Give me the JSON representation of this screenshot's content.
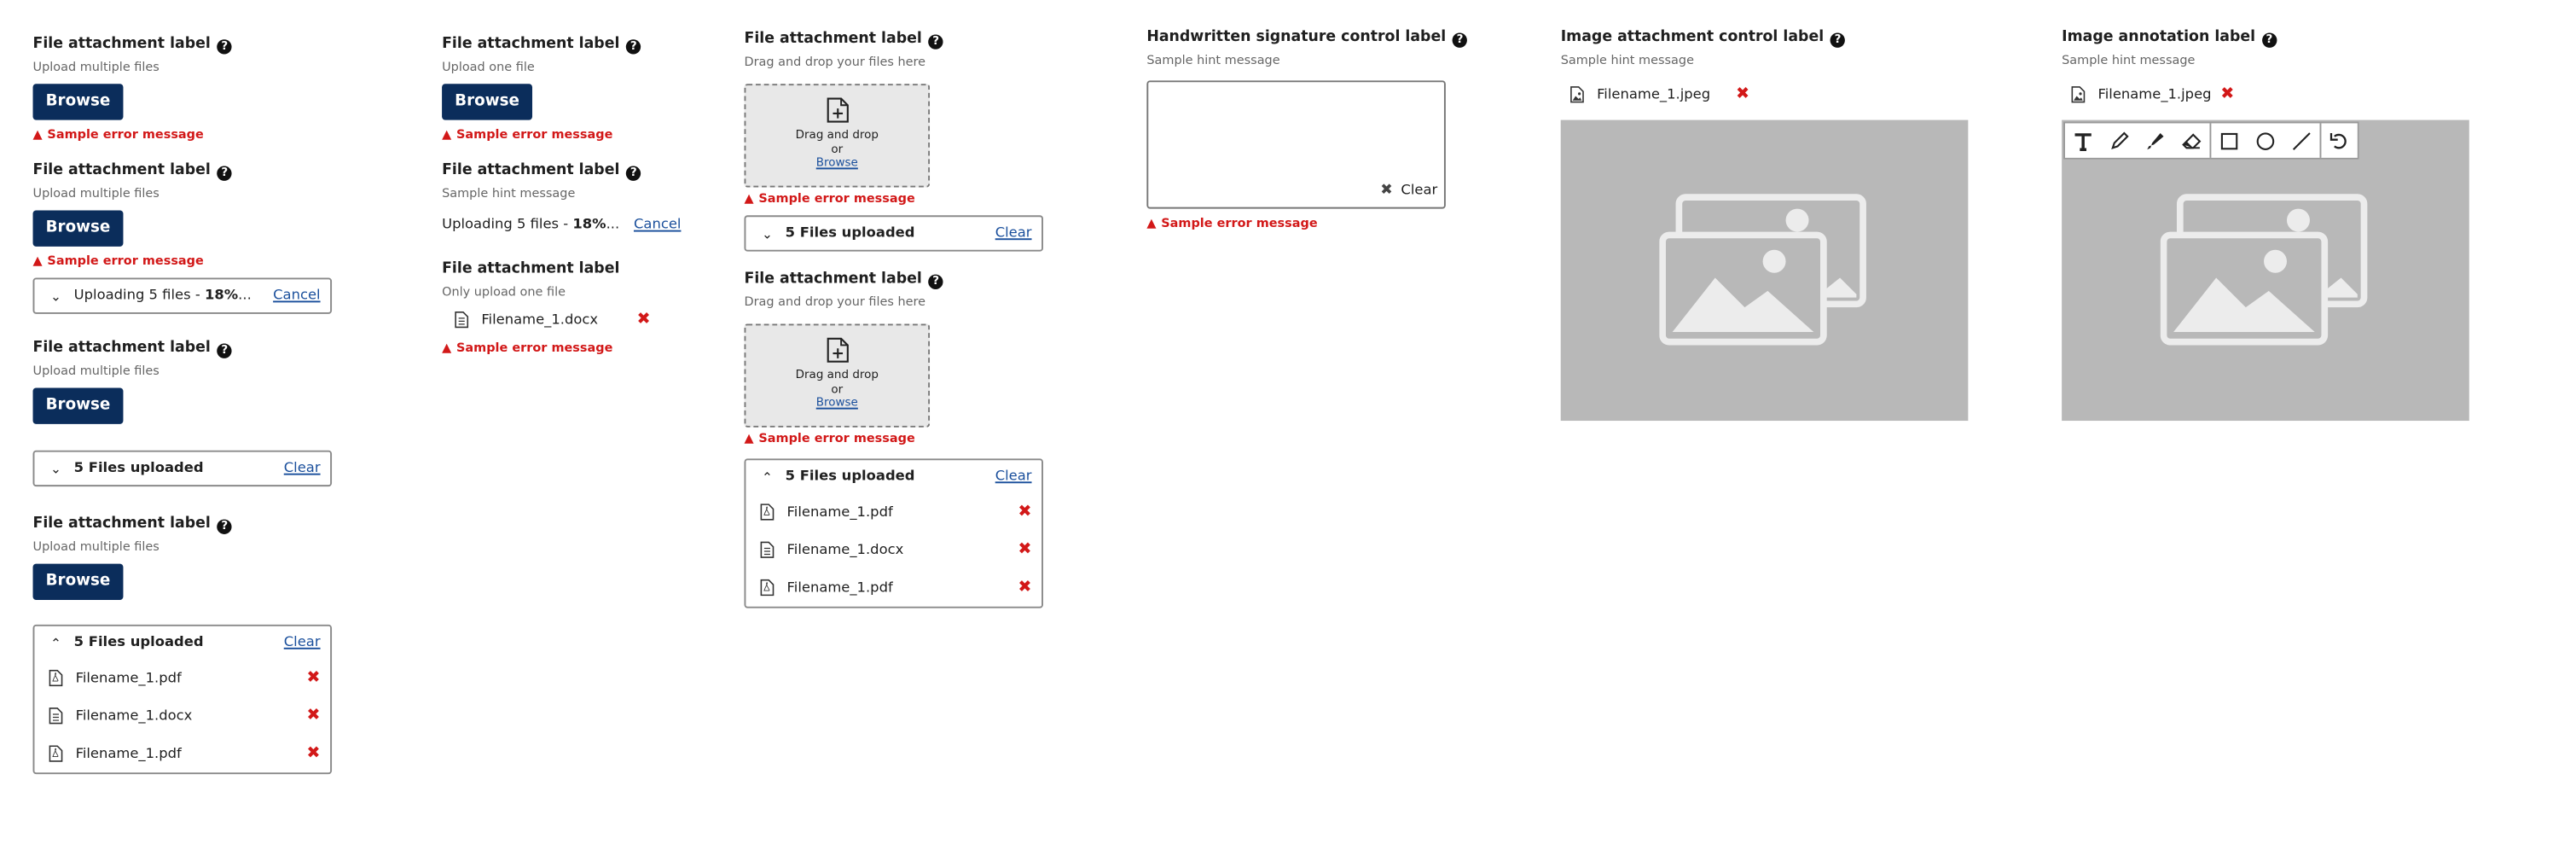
{
  "col1": {
    "b1": {
      "label": "File attachment label",
      "hint": "Upload multiple files",
      "button": "Browse",
      "error": "Sample error message"
    },
    "b2": {
      "label": "File attachment label",
      "hint": "Upload multiple files",
      "button": "Browse",
      "error": "Sample error message",
      "progress_prefix": "Uploading 5 files - ",
      "progress_percent": "18%",
      "progress_suffix": "...",
      "cancel": "Cancel"
    },
    "b3": {
      "label": "File attachment label",
      "hint": "Upload multiple files",
      "button": "Browse",
      "summary": "5 Files uploaded",
      "clear": "Clear"
    },
    "b4": {
      "label": "File attachment label",
      "hint": "Upload multiple files",
      "button": "Browse",
      "summary": "5 Files uploaded",
      "clear": "Clear",
      "files": [
        "Filename_1.pdf",
        "Filename_1.docx",
        "Filename_1.pdf"
      ]
    }
  },
  "col2": {
    "b1": {
      "label": "File attachment label",
      "hint": "Upload one file",
      "button": "Browse",
      "error": "Sample error message"
    },
    "b2": {
      "label": "File attachment label",
      "hint": "Sample hint message",
      "progress_prefix": "Uploading 5 files - ",
      "progress_percent": "18%",
      "progress_suffix": "...",
      "cancel": "Cancel"
    },
    "b3": {
      "label": "File attachment label",
      "hint": "Only upload one file",
      "file": "Filename_1.docx",
      "error": "Sample error message"
    }
  },
  "col3": {
    "b1": {
      "label": "File attachment label",
      "hint": "Drag and drop your files here",
      "dz_line1": "Drag and drop",
      "dz_or": "or",
      "dz_browse": "Browse",
      "error": "Sample error message",
      "summary": "5 Files uploaded",
      "clear": "Clear"
    },
    "b2": {
      "label": "File attachment label",
      "hint": "Drag and drop your files here",
      "dz_line1": "Drag and drop",
      "dz_or": "or",
      "dz_browse": "Browse",
      "error": "Sample error message",
      "summary": "5 Files uploaded",
      "clear": "Clear",
      "files": [
        "Filename_1.pdf",
        "Filename_1.docx",
        "Filename_1.pdf"
      ]
    }
  },
  "col4": {
    "label": "Handwritten signature control label",
    "hint": "Sample hint message",
    "clear": "Clear",
    "error": "Sample error message"
  },
  "col5": {
    "label": "Image attachment control label",
    "hint": "Sample hint message",
    "file": "Filename_1.jpeg"
  },
  "col6": {
    "label": "Image annotation label",
    "hint": "Sample hint message",
    "file": "Filename_1.jpeg",
    "tools": [
      "text-tool-icon",
      "pencil-icon",
      "marker-icon",
      "eraser-icon",
      "rectangle-icon",
      "circle-icon",
      "line-icon",
      "undo-icon"
    ]
  },
  "colors": {
    "primary_button": "#0b2d5b",
    "error": "#d21818",
    "link": "#1a4f9c",
    "image_placeholder": "#b8b8b8"
  }
}
